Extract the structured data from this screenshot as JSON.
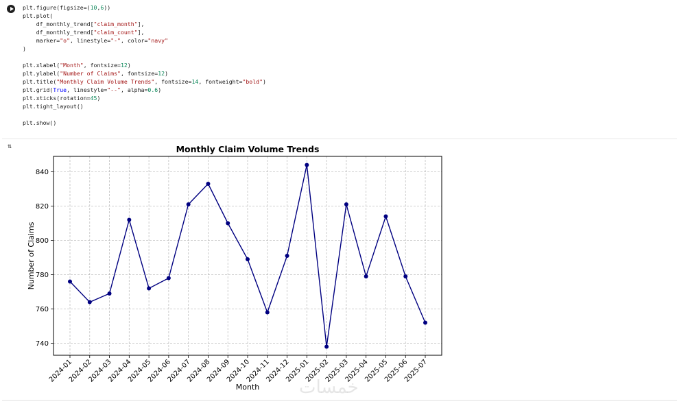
{
  "code": {
    "lines": [
      "plt.figure(figsize=(10,6))",
      "plt.plot(",
      "    df_monthly_trend[\"claim_month\"],",
      "    df_monthly_trend[\"claim_count\"],",
      "    marker=\"o\", linestyle=\"-\", color=\"navy\"",
      ")",
      "",
      "plt.xlabel(\"Month\", fontsize=12)",
      "plt.ylabel(\"Number of Claims\", fontsize=12)",
      "plt.title(\"Monthly Claim Volume Trends\", fontsize=14, fontweight=\"bold\")",
      "plt.grid(True, linestyle=\"--\", alpha=0.6)",
      "plt.xticks(rotation=45)",
      "plt.tight_layout()",
      "",
      "plt.show()"
    ]
  },
  "output_icon": "output-toggle-icon",
  "watermark": "خمسات",
  "colors": {
    "line": "#000080",
    "grid": "#b0b0b0"
  },
  "chart_data": {
    "type": "line",
    "title": "Monthly Claim Volume Trends",
    "xlabel": "Month",
    "ylabel": "Number of Claims",
    "categories": [
      "2024-01",
      "2024-02",
      "2024-03",
      "2024-04",
      "2024-05",
      "2024-06",
      "2024-07",
      "2024-08",
      "2024-09",
      "2024-10",
      "2024-11",
      "2024-12",
      "2025-01",
      "2025-02",
      "2025-03",
      "2025-04",
      "2025-05",
      "2025-06",
      "2025-07"
    ],
    "values": [
      776,
      764,
      769,
      812,
      772,
      778,
      821,
      833,
      810,
      789,
      758,
      791,
      844,
      738,
      821,
      779,
      814,
      779,
      752
    ],
    "yticks": [
      740,
      760,
      780,
      800,
      820,
      840
    ],
    "ylim": [
      733,
      849
    ],
    "grid": true,
    "marker": "o",
    "color": "navy"
  }
}
